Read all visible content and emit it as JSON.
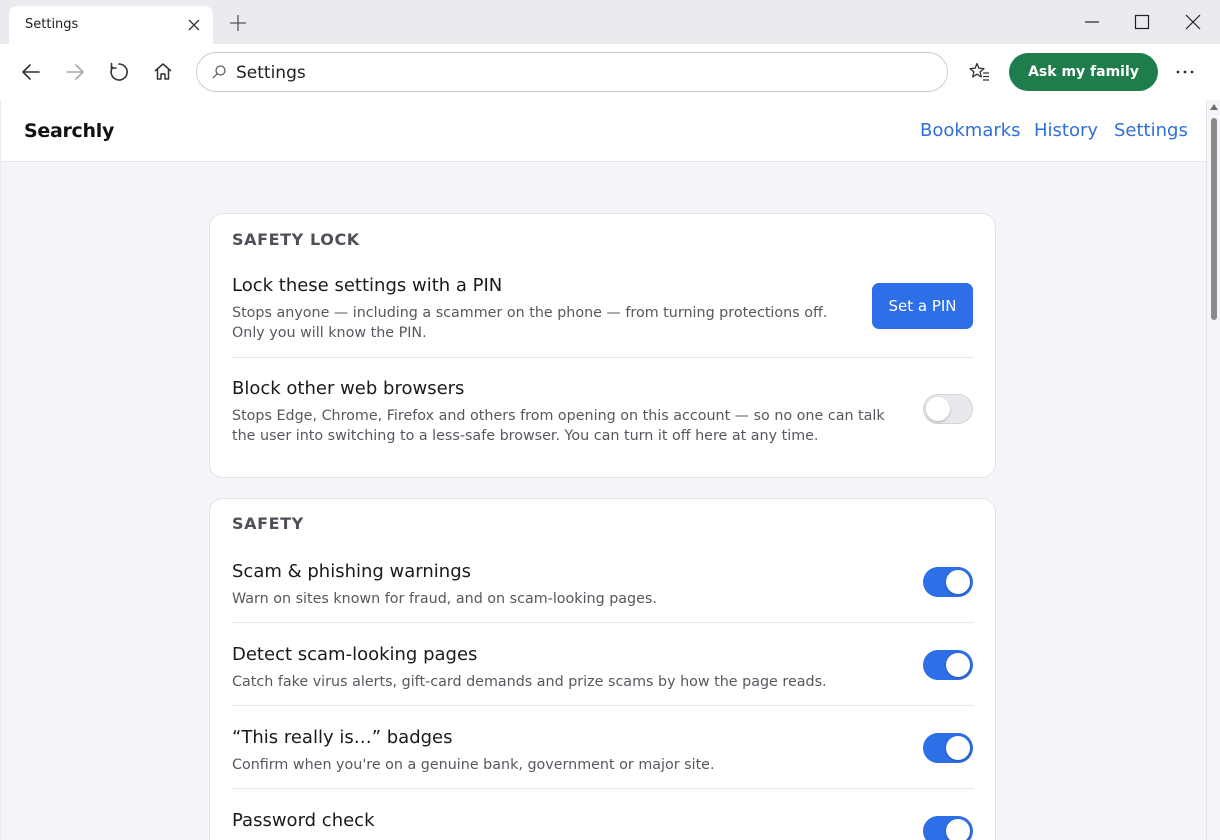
{
  "tab": {
    "title": "Settings"
  },
  "address_bar": {
    "value": "Settings"
  },
  "toolbar": {
    "ask_family_label": "Ask my family"
  },
  "site": {
    "brand": "Searchly",
    "nav": [
      "Bookmarks",
      "History",
      "Settings"
    ]
  },
  "safety_lock": {
    "heading": "SAFETY LOCK",
    "pin": {
      "title": "Lock these settings with a PIN",
      "desc": "Stops anyone — including a scammer on the phone — from turning protections off. Only you will know the PIN.",
      "button": "Set a PIN"
    },
    "block_browsers": {
      "title": "Block other web browsers",
      "desc": "Stops Edge, Chrome, Firefox and others from opening on this account — so no one can talk the user into switching to a less-safe browser. You can turn it off here at any time.",
      "enabled": false
    }
  },
  "safety": {
    "heading": "SAFETY",
    "items": [
      {
        "title": "Scam & phishing warnings",
        "desc": "Warn on sites known for fraud, and on scam-looking pages.",
        "enabled": true
      },
      {
        "title": "Detect scam-looking pages",
        "desc": "Catch fake virus alerts, gift-card demands and prize scams by how the page reads.",
        "enabled": true
      },
      {
        "title": "“This really is…” badges",
        "desc": "Confirm when you're on a genuine bank, government or major site.",
        "enabled": true
      },
      {
        "title": "Password check",
        "desc": "",
        "enabled": true
      }
    ]
  },
  "colors": {
    "accent": "#2e6ee6",
    "family_button": "#1e7d4b",
    "link": "#2f6fd6"
  }
}
